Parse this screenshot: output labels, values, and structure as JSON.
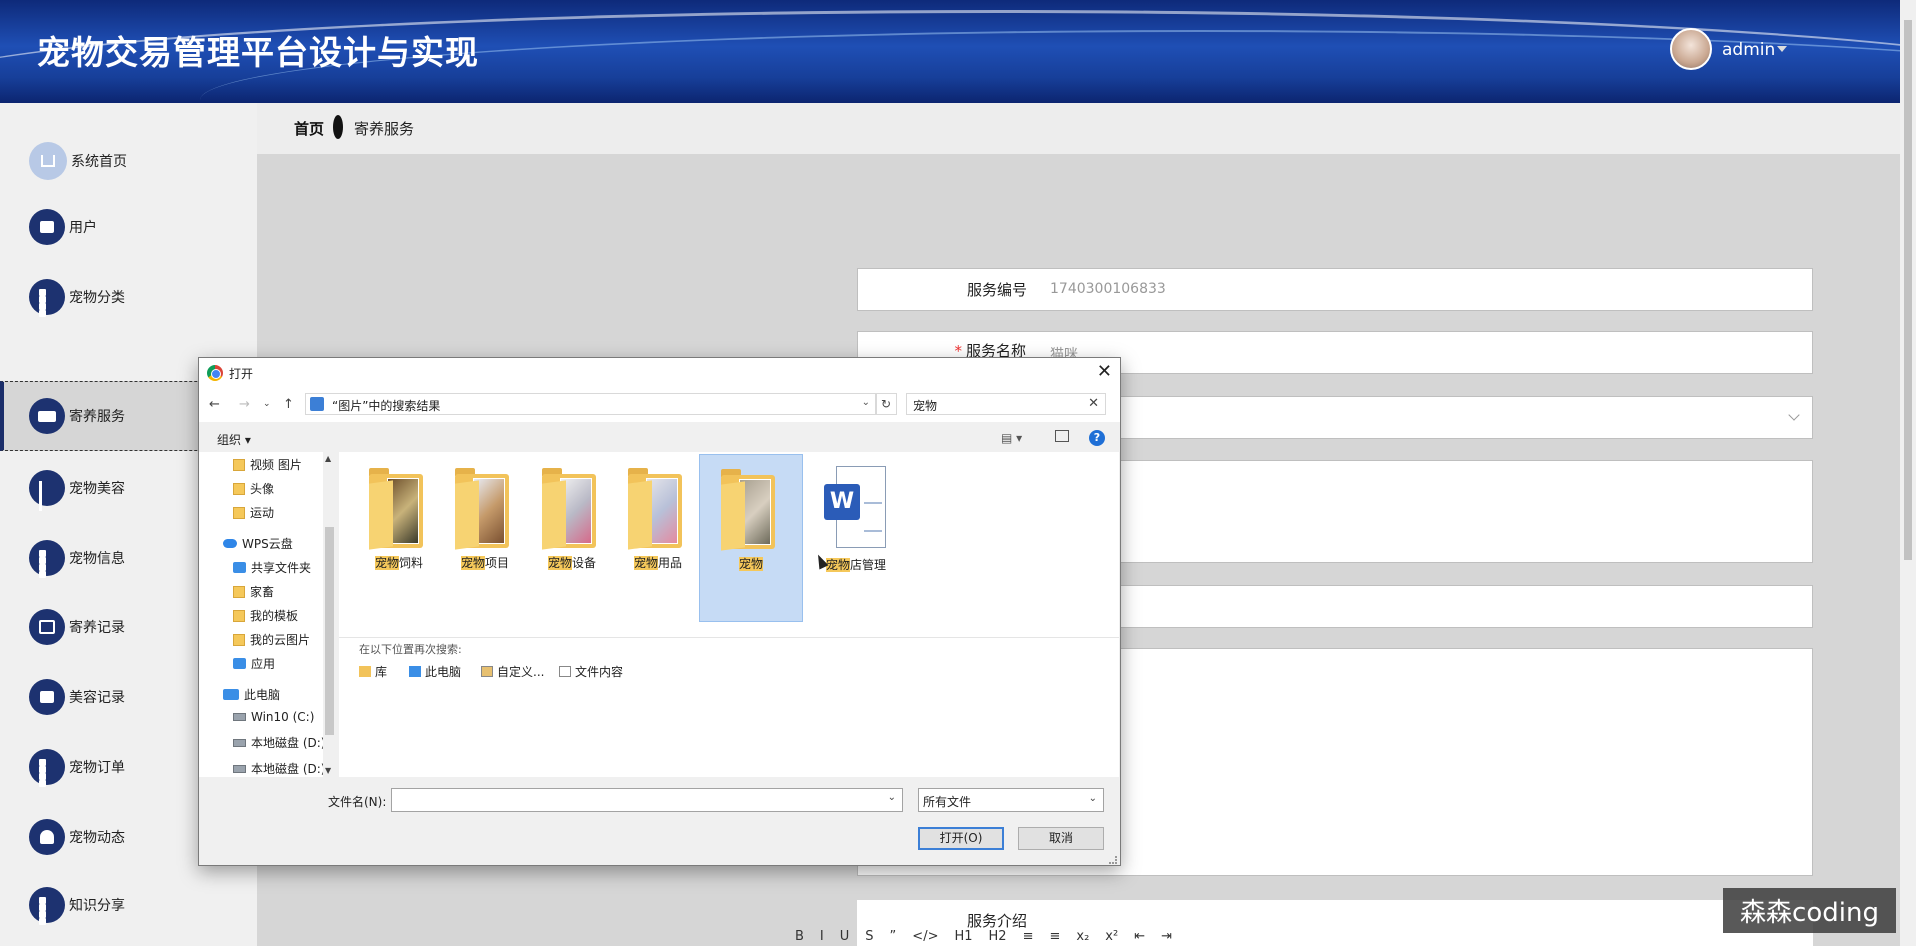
{
  "header": {
    "title": "宠物交易管理平台设计与实现",
    "username": "admin"
  },
  "sidebar": {
    "items": [
      {
        "label": "系统首页",
        "icon": "home-icon"
      },
      {
        "label": "用户",
        "icon": "print-icon"
      },
      {
        "label": "宠物分类",
        "icon": "grid-icon"
      },
      {
        "label": "寄养服务",
        "icon": "ticket-icon",
        "active": true
      },
      {
        "label": "宠物美容",
        "icon": "bar-chart-icon"
      },
      {
        "label": "宠物信息",
        "icon": "grid-icon"
      },
      {
        "label": "寄养记录",
        "icon": "line-chart-icon"
      },
      {
        "label": "美容记录",
        "icon": "print-icon"
      },
      {
        "label": "宠物订单",
        "icon": "grid-icon"
      },
      {
        "label": "宠物动态",
        "icon": "stamp-icon"
      },
      {
        "label": "知识分享",
        "icon": "grid-icon"
      }
    ]
  },
  "breadcrumb": {
    "home": "首页",
    "current": "寄养服务"
  },
  "form": {
    "service_no_label": "服务编号",
    "service_no_value": "1740300106833",
    "service_name_label": "服务名称",
    "service_name_required": "*",
    "service_name_value": "猫咪",
    "service_intro_label": "服务介绍"
  },
  "editor": {
    "toolbar": [
      "B",
      "I",
      "U",
      "S",
      "”",
      "</>",
      "H1",
      "H2",
      "≡",
      "≡",
      "x₂",
      "x²",
      "⇤",
      "⇥"
    ]
  },
  "dialog": {
    "title": "打开",
    "address": "“图片”中的搜索结果",
    "search_value": "宠物",
    "organize": "组织",
    "tree": [
      {
        "label": "视频 图片",
        "icon": "folder-icon"
      },
      {
        "label": "头像",
        "icon": "folder-icon"
      },
      {
        "label": "运动",
        "icon": "folder-icon"
      },
      {
        "label": "WPS云盘",
        "icon": "cloud-icon"
      },
      {
        "label": "共享文件夹",
        "icon": "share-icon"
      },
      {
        "label": "家畜",
        "icon": "folder-icon"
      },
      {
        "label": "我的模板",
        "icon": "folder-icon"
      },
      {
        "label": "我的云图片",
        "icon": "folder-icon"
      },
      {
        "label": "应用",
        "icon": "apps-icon"
      },
      {
        "label": "此电脑",
        "icon": "computer-icon"
      },
      {
        "label": "Win10 (C:)",
        "icon": "disk-icon"
      },
      {
        "label": "本地磁盘 (D:)",
        "icon": "disk-icon"
      },
      {
        "label": "本地磁盘 (D:)",
        "icon": "disk-icon"
      }
    ],
    "files": [
      {
        "hl": "宠物",
        "rest": "饲料",
        "type": "folder"
      },
      {
        "hl": "宠物",
        "rest": "项目",
        "type": "folder"
      },
      {
        "hl": "宠物",
        "rest": "设备",
        "type": "folder"
      },
      {
        "hl": "宠物",
        "rest": "用品",
        "type": "folder"
      },
      {
        "hl": "宠物",
        "rest": "",
        "type": "folder",
        "selected": true
      },
      {
        "hl": "宠物",
        "rest": "店管理",
        "type": "word"
      }
    ],
    "research_header": "在以下位置再次搜索:",
    "research_options": [
      "库",
      "此电脑",
      "自定义...",
      "文件内容"
    ],
    "filename_label": "文件名(N):",
    "filename_value": "",
    "filetype_value": "所有文件",
    "open_button": "打开(O)",
    "cancel_button": "取消"
  },
  "watermark": "森森coding"
}
